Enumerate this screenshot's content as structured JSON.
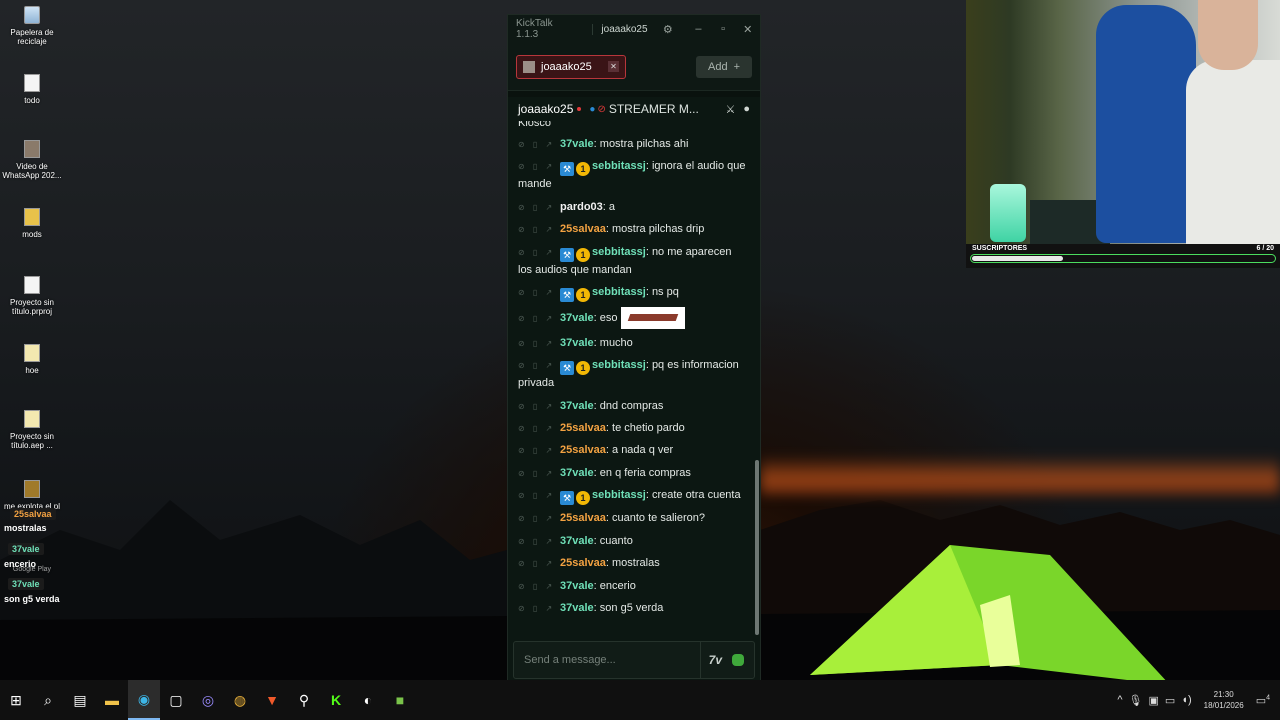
{
  "desktop": {
    "icons": [
      {
        "label": "Papelera de reciclaje",
        "icon": "recycle-bin-icon"
      },
      {
        "label": "todo",
        "icon": "document-icon"
      },
      {
        "label": "Video de WhatsApp 202...",
        "icon": "video-file-icon"
      },
      {
        "label": "mods",
        "icon": "folder-icon"
      },
      {
        "label": "Proyecto sin título.prproj",
        "icon": "document-icon"
      },
      {
        "label": "hoe",
        "icon": "file-icon"
      },
      {
        "label": "Proyecto sin título.aep ...",
        "icon": "document-icon"
      },
      {
        "label": "me explota el pl",
        "icon": "file-icon"
      }
    ],
    "hidden_icon_label": "Google Play"
  },
  "overlay_chat": [
    {
      "user": "25salvaa",
      "text": "mostralas"
    },
    {
      "user": "37vale",
      "text": "encerio"
    },
    {
      "user": "37vale",
      "text": "son g5 verda"
    }
  ],
  "kicktalk": {
    "app_title": "KickTalk 1.1.3",
    "title_user": "joaaako25",
    "tab_label": "joaaako25",
    "add_label": "Add",
    "channel_name": "joaaako25",
    "channel_mode": "STREAMER M...",
    "cut_text": "Kiosco",
    "input_placeholder": "Send a message...",
    "messages": [
      {
        "user": "37vale",
        "text": "mostra pilchas ahi"
      },
      {
        "user": "sebbitassj",
        "text": "ignora el audio que mande"
      },
      {
        "user": "pardo03",
        "text": "a"
      },
      {
        "user": "25salvaa",
        "text": "mostra pilchas drip"
      },
      {
        "user": "sebbitassj",
        "text": "no me aparecen los audios que mandan"
      },
      {
        "user": "sebbitassj",
        "text": "ns pq"
      },
      {
        "user": "37vale",
        "text": "eso"
      },
      {
        "user": "37vale",
        "text": "mucho"
      },
      {
        "user": "sebbitassj",
        "text": "pq es informacion privada"
      },
      {
        "user": "37vale",
        "text": "dnd compras"
      },
      {
        "user": "25salvaa",
        "text": "te chetio pardo"
      },
      {
        "user": "25salvaa",
        "text": "a nada q ver"
      },
      {
        "user": "37vale",
        "text": "en q feria compras"
      },
      {
        "user": "sebbitassj",
        "text": "create otra cuenta"
      },
      {
        "user": "25salvaa",
        "text": "cuanto te salieron?"
      },
      {
        "user": "37vale",
        "text": "cuanto"
      },
      {
        "user": "25salvaa",
        "text": "mostralas"
      },
      {
        "user": "37vale",
        "text": "encerio"
      },
      {
        "user": "37vale",
        "text": "son g5 verda"
      }
    ],
    "colors": {
      "teal": "#6fe0b8",
      "orange": "#f3a242",
      "accent_red": "#b8363b"
    }
  },
  "webcam": {
    "subs_label": "SUSCRIPTORES",
    "subs_count": "6 / 20",
    "subs_progress": 0.3
  },
  "taskbar": {
    "time": "21:30",
    "date": "18/01/2026",
    "notifications": "4"
  }
}
